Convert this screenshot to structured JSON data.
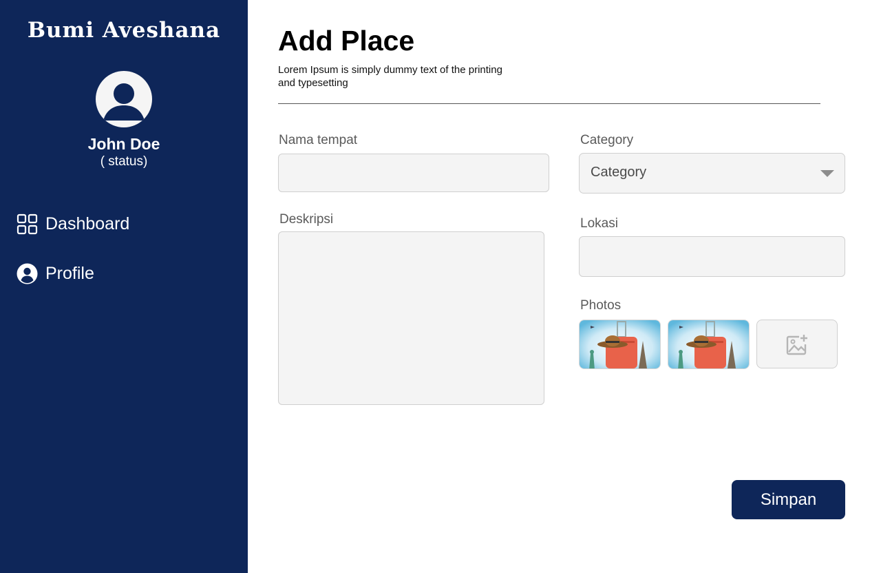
{
  "sidebar": {
    "brand": "Bumi Aveshana",
    "user": {
      "name": "John Doe",
      "status": "( status)",
      "avatar_icon": "user-avatar-icon"
    },
    "nav": [
      {
        "label": "Dashboard",
        "icon": "grid-icon"
      },
      {
        "label": "Profile",
        "icon": "user-circle-icon"
      }
    ]
  },
  "main": {
    "title": "Add Place",
    "subtitle": "Lorem Ipsum is simply dummy text of the printing and typesetting",
    "form": {
      "nama_tempat": {
        "label": "Nama tempat",
        "value": ""
      },
      "deskripsi": {
        "label": "Deskripsi",
        "value": ""
      },
      "category": {
        "label": "Category",
        "selected": "Category"
      },
      "lokasi": {
        "label": "Lokasi",
        "value": ""
      },
      "photos": {
        "label": "Photos",
        "add_icon": "add-image-icon"
      }
    },
    "save_label": "Simpan"
  },
  "colors": {
    "sidebar_bg": "#0e2659",
    "button_bg": "#0e2659",
    "input_bg": "#f4f4f4"
  }
}
